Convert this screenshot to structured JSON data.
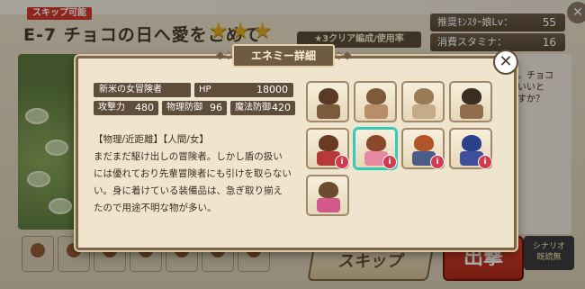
{
  "header": {
    "skip_tag": "スキップ可能",
    "stage_title": "E-7 チョコの日へ愛をこめて",
    "stars": "★★★",
    "party_button": "★3クリア編成/使用率",
    "recommended_label": "推奨ﾓﾝｽﾀｰ娘Lv：",
    "recommended_value": "55",
    "stamina_label": "消費スタミナ：",
    "stamina_value": "16"
  },
  "side_text": "た。チョコ\nていいと\nですか？",
  "buttons": {
    "skip": "スキップ",
    "sortie": "出撃",
    "scenario": "シナリオ\n既読無"
  },
  "modal": {
    "title": "エネミー詳細",
    "close_icon": "✕",
    "enemy_name": "新米の女冒険者",
    "hp_label": "HP",
    "hp_value": "18000",
    "attack_label": "攻撃力",
    "attack_value": "480",
    "phys_def_label": "物理防御",
    "phys_def_value": "96",
    "mag_def_label": "魔法防御",
    "mag_def_value": "420",
    "desc_lines": [
      "【物理/近距離】【人間/女】",
      "まだまだ駆け出しの冒険者。しかし盾の扱い",
      "には優れており先輩冒険者にも引けを取らない",
      "い。身に着けている装備品は、急ぎ取り揃え",
      "たので用途不明な物が多い。"
    ],
    "enemies": [
      {
        "name": "enemy-bandit",
        "hair": "#5a3a24",
        "cloth": "#7a5b3c",
        "badge": ""
      },
      {
        "name": "enemy-brute",
        "hair": "#7d5a3a",
        "cloth": "#b88e6a",
        "badge": ""
      },
      {
        "name": "enemy-armored",
        "hair": "#9a7b58",
        "cloth": "#c6ab88",
        "badge": ""
      },
      {
        "name": "enemy-axeman",
        "hair": "#3b2b20",
        "cloth": "#8f6d4d",
        "badge": ""
      },
      {
        "name": "enemy-ogre",
        "hair": "#6b3a22",
        "cloth": "#b73a3a",
        "badge": "i"
      },
      {
        "name": "enemy-female-adventurer",
        "hair": "#8a4a2a",
        "cloth": "#e58aa0",
        "badge": "i"
      },
      {
        "name": "enemy-swordsman",
        "hair": "#b0552a",
        "cloth": "#4d5b88",
        "badge": "i"
      },
      {
        "name": "enemy-mage",
        "hair": "#2b3f8a",
        "cloth": "#3c4f9a",
        "badge": "i"
      },
      {
        "name": "enemy-plant",
        "hair": "#6a4a30",
        "cloth": "#d15a8a",
        "badge": ""
      }
    ]
  }
}
